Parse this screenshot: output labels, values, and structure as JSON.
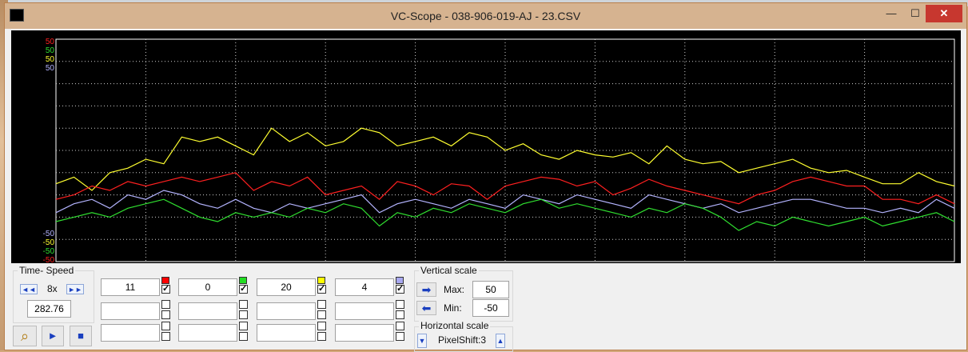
{
  "window": {
    "title": "VC-Scope   -   038-906-019-AJ   -   23.CSV",
    "minimize_glyph": "—",
    "maximize_glyph": "☐",
    "close_glyph": "✕"
  },
  "scope": {
    "top_scale_labels": [
      {
        "text": "50",
        "color": "#ff2020"
      },
      {
        "text": "50",
        "color": "#30e030"
      },
      {
        "text": "50",
        "color": "#ffff30"
      },
      {
        "text": "50",
        "color": "#b4b4ff"
      }
    ],
    "bottom_scale_labels": [
      {
        "text": "-50",
        "color": "#b4b4ff"
      },
      {
        "text": "-50",
        "color": "#ffff30"
      },
      {
        "text": "-50",
        "color": "#30e030"
      },
      {
        "text": "-50",
        "color": "#ff2020"
      }
    ],
    "traces": [
      {
        "color": "#ffff30",
        "points": [
          [
            0,
            -15
          ],
          [
            2,
            -12
          ],
          [
            4,
            -18
          ],
          [
            6,
            -10
          ],
          [
            8,
            -8
          ],
          [
            10,
            -4
          ],
          [
            12,
            -6
          ],
          [
            14,
            6
          ],
          [
            16,
            4
          ],
          [
            18,
            6
          ],
          [
            20,
            2
          ],
          [
            22,
            -2
          ],
          [
            24,
            10
          ],
          [
            26,
            4
          ],
          [
            28,
            8
          ],
          [
            30,
            2
          ],
          [
            32,
            4
          ],
          [
            34,
            10
          ],
          [
            36,
            8
          ],
          [
            38,
            2
          ],
          [
            40,
            4
          ],
          [
            42,
            6
          ],
          [
            44,
            2
          ],
          [
            46,
            8
          ],
          [
            48,
            6
          ],
          [
            50,
            0
          ],
          [
            52,
            3
          ],
          [
            54,
            -2
          ],
          [
            56,
            -4
          ],
          [
            58,
            0
          ],
          [
            60,
            -2
          ],
          [
            62,
            -3
          ],
          [
            64,
            -1
          ],
          [
            66,
            -6
          ],
          [
            68,
            2
          ],
          [
            70,
            -4
          ],
          [
            72,
            -6
          ],
          [
            74,
            -5
          ],
          [
            76,
            -10
          ],
          [
            78,
            -8
          ],
          [
            80,
            -6
          ],
          [
            82,
            -4
          ],
          [
            84,
            -8
          ],
          [
            86,
            -10
          ],
          [
            88,
            -9
          ],
          [
            90,
            -12
          ],
          [
            92,
            -15
          ],
          [
            94,
            -15
          ],
          [
            96,
            -10
          ],
          [
            98,
            -14
          ],
          [
            100,
            -16
          ]
        ]
      },
      {
        "color": "#ff2020",
        "points": [
          [
            0,
            -22
          ],
          [
            2,
            -20
          ],
          [
            4,
            -16
          ],
          [
            6,
            -18
          ],
          [
            8,
            -14
          ],
          [
            10,
            -16
          ],
          [
            12,
            -14
          ],
          [
            14,
            -12
          ],
          [
            16,
            -14
          ],
          [
            18,
            -12
          ],
          [
            20,
            -10
          ],
          [
            22,
            -18
          ],
          [
            24,
            -14
          ],
          [
            26,
            -16
          ],
          [
            28,
            -12
          ],
          [
            30,
            -20
          ],
          [
            32,
            -18
          ],
          [
            34,
            -16
          ],
          [
            36,
            -22
          ],
          [
            38,
            -14
          ],
          [
            40,
            -16
          ],
          [
            42,
            -20
          ],
          [
            44,
            -15
          ],
          [
            46,
            -16
          ],
          [
            48,
            -22
          ],
          [
            50,
            -16
          ],
          [
            52,
            -14
          ],
          [
            54,
            -12
          ],
          [
            56,
            -13
          ],
          [
            58,
            -16
          ],
          [
            60,
            -14
          ],
          [
            62,
            -20
          ],
          [
            64,
            -17
          ],
          [
            66,
            -13
          ],
          [
            68,
            -16
          ],
          [
            70,
            -18
          ],
          [
            72,
            -20
          ],
          [
            74,
            -22
          ],
          [
            76,
            -24
          ],
          [
            78,
            -20
          ],
          [
            80,
            -18
          ],
          [
            82,
            -14
          ],
          [
            84,
            -12
          ],
          [
            86,
            -14
          ],
          [
            88,
            -16
          ],
          [
            90,
            -16
          ],
          [
            92,
            -22
          ],
          [
            94,
            -22
          ],
          [
            96,
            -24
          ],
          [
            98,
            -20
          ],
          [
            100,
            -24
          ]
        ]
      },
      {
        "color": "#b4b4ff",
        "points": [
          [
            0,
            -28
          ],
          [
            2,
            -24
          ],
          [
            4,
            -22
          ],
          [
            6,
            -26
          ],
          [
            8,
            -20
          ],
          [
            10,
            -22
          ],
          [
            12,
            -18
          ],
          [
            14,
            -20
          ],
          [
            16,
            -24
          ],
          [
            18,
            -26
          ],
          [
            20,
            -22
          ],
          [
            22,
            -26
          ],
          [
            24,
            -28
          ],
          [
            26,
            -24
          ],
          [
            28,
            -26
          ],
          [
            30,
            -24
          ],
          [
            32,
            -22
          ],
          [
            34,
            -20
          ],
          [
            36,
            -28
          ],
          [
            38,
            -24
          ],
          [
            40,
            -22
          ],
          [
            42,
            -24
          ],
          [
            44,
            -26
          ],
          [
            46,
            -22
          ],
          [
            48,
            -24
          ],
          [
            50,
            -26
          ],
          [
            52,
            -20
          ],
          [
            54,
            -22
          ],
          [
            56,
            -24
          ],
          [
            58,
            -20
          ],
          [
            60,
            -22
          ],
          [
            62,
            -24
          ],
          [
            64,
            -26
          ],
          [
            66,
            -20
          ],
          [
            68,
            -22
          ],
          [
            70,
            -24
          ],
          [
            72,
            -26
          ],
          [
            74,
            -24
          ],
          [
            76,
            -28
          ],
          [
            78,
            -26
          ],
          [
            80,
            -24
          ],
          [
            82,
            -22
          ],
          [
            84,
            -22
          ],
          [
            86,
            -24
          ],
          [
            88,
            -26
          ],
          [
            90,
            -26
          ],
          [
            92,
            -28
          ],
          [
            94,
            -26
          ],
          [
            96,
            -28
          ],
          [
            98,
            -22
          ],
          [
            100,
            -26
          ]
        ]
      },
      {
        "color": "#30e030",
        "points": [
          [
            0,
            -32
          ],
          [
            2,
            -30
          ],
          [
            4,
            -28
          ],
          [
            6,
            -30
          ],
          [
            8,
            -26
          ],
          [
            10,
            -24
          ],
          [
            12,
            -22
          ],
          [
            14,
            -26
          ],
          [
            16,
            -30
          ],
          [
            18,
            -32
          ],
          [
            20,
            -28
          ],
          [
            22,
            -30
          ],
          [
            24,
            -28
          ],
          [
            26,
            -30
          ],
          [
            28,
            -26
          ],
          [
            30,
            -28
          ],
          [
            32,
            -24
          ],
          [
            34,
            -26
          ],
          [
            36,
            -34
          ],
          [
            38,
            -28
          ],
          [
            40,
            -30
          ],
          [
            42,
            -26
          ],
          [
            44,
            -28
          ],
          [
            46,
            -24
          ],
          [
            48,
            -26
          ],
          [
            50,
            -28
          ],
          [
            52,
            -24
          ],
          [
            54,
            -22
          ],
          [
            56,
            -26
          ],
          [
            58,
            -24
          ],
          [
            60,
            -26
          ],
          [
            62,
            -28
          ],
          [
            64,
            -30
          ],
          [
            66,
            -26
          ],
          [
            68,
            -28
          ],
          [
            70,
            -24
          ],
          [
            72,
            -26
          ],
          [
            74,
            -30
          ],
          [
            76,
            -36
          ],
          [
            78,
            -32
          ],
          [
            80,
            -34
          ],
          [
            82,
            -30
          ],
          [
            84,
            -32
          ],
          [
            86,
            -34
          ],
          [
            88,
            -32
          ],
          [
            90,
            -30
          ],
          [
            92,
            -34
          ],
          [
            94,
            -32
          ],
          [
            96,
            -30
          ],
          [
            98,
            -28
          ],
          [
            100,
            -32
          ]
        ]
      }
    ]
  },
  "time_speed": {
    "title": "Time- Speed",
    "rewind_glyph": "◄◄",
    "speed": "8x",
    "forward_glyph": "►►",
    "position": "282.76"
  },
  "bottom_buttons": {
    "zoom_glyph": "⌕",
    "play_glyph": "►",
    "stop_glyph": "■"
  },
  "channels": [
    {
      "value": "11",
      "color": "#ff0000",
      "checked": "✓"
    },
    {
      "value": "0",
      "color": "#22dd22",
      "checked": "✓"
    },
    {
      "value": "20",
      "color": "#ffff00",
      "checked": "✓"
    },
    {
      "value": "4",
      "color": "#a8a8f0",
      "checked": "✓"
    }
  ],
  "vertical_scale": {
    "title": "Vertical scale",
    "max_label": "Max:",
    "max_value": "50",
    "min_label": "Min:",
    "min_value": "-50",
    "up_glyph": "➡",
    "down_glyph": "⬅"
  },
  "horizontal_scale": {
    "title": "Horizontal scale",
    "value": "PixelShift:3",
    "down_glyph": "▼",
    "up_glyph": "▲"
  }
}
